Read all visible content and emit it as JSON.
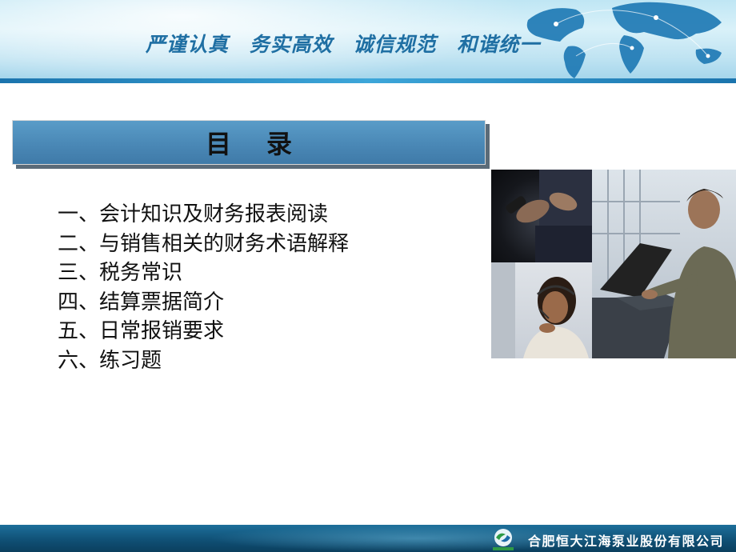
{
  "header": {
    "slogan": [
      "严谨认真",
      "务实高效",
      "诚信规范",
      "和谐统一"
    ]
  },
  "title": "目录",
  "toc": [
    "一、会计知识及财务报表阅读",
    "二、与销售相关的财务术语解释",
    "三、税务常识",
    "四、结算票据简介",
    "五、日常报销要求",
    "六、练习题"
  ],
  "footer": {
    "company": "合肥恒大江海泵业股份有限公司"
  },
  "colors": {
    "title_bar": "#4a88b6",
    "banner": "#bfe6f4",
    "footer": "#0f4e73",
    "slogan": "#1f6fa3"
  },
  "icons": [
    "world-map-graphic",
    "company-logo-icon"
  ]
}
